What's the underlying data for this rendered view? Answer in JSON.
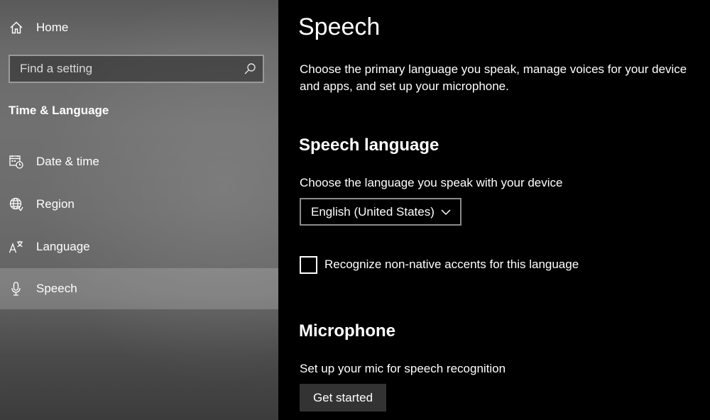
{
  "sidebar": {
    "home_label": "Home",
    "search": {
      "placeholder": "Find a setting",
      "value": ""
    },
    "section_title": "Time & Language",
    "items": [
      {
        "label": "Date & time",
        "icon": "calendar-clock-icon",
        "selected": false
      },
      {
        "label": "Region",
        "icon": "globe-icon",
        "selected": false
      },
      {
        "label": "Language",
        "icon": "language-icon",
        "selected": false
      },
      {
        "label": "Speech",
        "icon": "microphone-icon",
        "selected": true
      }
    ]
  },
  "main": {
    "title": "Speech",
    "intro": "Choose the primary language you speak, manage voices for your device and apps, and set up your microphone.",
    "speech_language": {
      "heading": "Speech language",
      "prompt": "Choose the language you speak with your device",
      "selected_language": "English (United States)",
      "accent_checkbox_label": "Recognize non-native accents for this language",
      "accent_checked": false
    },
    "microphone": {
      "heading": "Microphone",
      "prompt": "Set up your mic for speech recognition",
      "button_label": "Get started"
    }
  },
  "colors": {
    "background": "#000000",
    "sidebar_selected": "#8a8a8a",
    "button_bg": "#333333"
  }
}
